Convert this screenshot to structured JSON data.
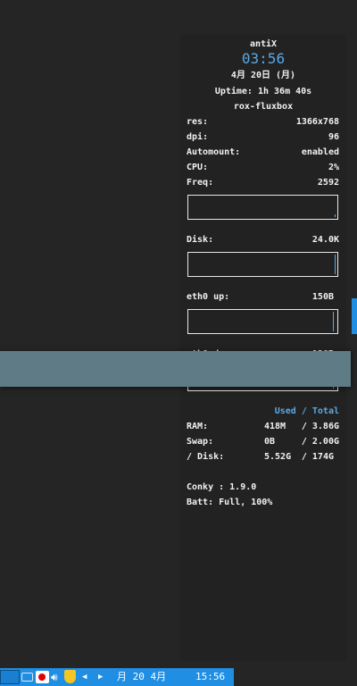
{
  "conky": {
    "hostname": "antiX",
    "time": "03:56",
    "date": "4月 20日 (月)",
    "uptime": "Uptime: 1h 36m 40s",
    "wm": "rox-fluxbox",
    "rows": [
      {
        "label": "res:",
        "value": "1366x768"
      },
      {
        "label": "dpi:",
        "value": "96"
      },
      {
        "label": "Automount:",
        "value": "enabled"
      },
      {
        "label": "CPU:",
        "value": "2%"
      },
      {
        "label": "Freq:",
        "value": "2592"
      }
    ],
    "disk_label": "Disk:",
    "disk_value": "24.0K",
    "eth_up_label": "eth0 up:",
    "eth_up_value": "150B",
    "eth_down_label": "eth0 down:",
    "eth_down_value": "130B",
    "used_total_header": "Used / Total",
    "mem": [
      {
        "label": "RAM:",
        "used": "418M",
        "total": "/ 3.86G"
      },
      {
        "label": "Swap:",
        "used": "0B",
        "total": "/ 2.00G"
      },
      {
        "label": "/ Disk:",
        "used": "5.52G",
        "total": "/ 174G"
      }
    ],
    "conky_version": "Conky : 1.9.0",
    "battery": "Batt: Full, 100%"
  },
  "taskbar": {
    "clock_date": "月 20  4月",
    "clock_time": "15:56",
    "icons": [
      "start-menu-icon",
      "keyboard-icon",
      "japan-flag-icon",
      "volume-icon",
      "shield-icon",
      "arrow-left-icon",
      "arrow-right-icon"
    ]
  },
  "colors": {
    "accent": "#5aa9e6",
    "taskbar": "#1f8ee3",
    "window_strip": "#5f7b85",
    "background": "#252525"
  }
}
